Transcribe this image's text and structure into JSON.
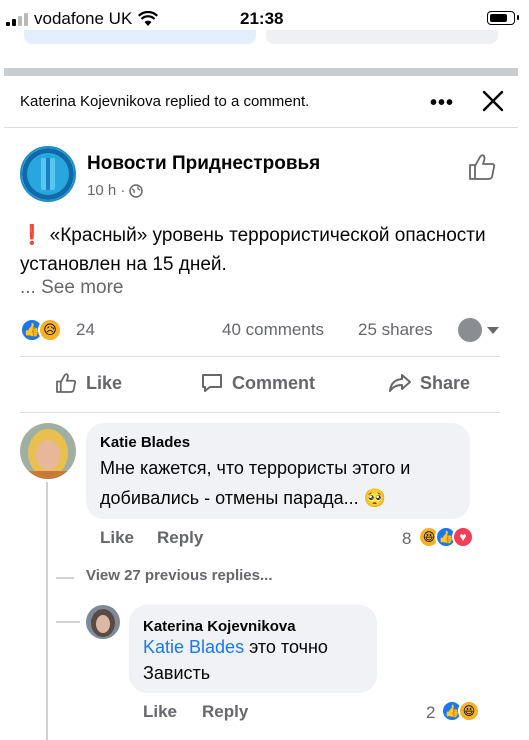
{
  "status_bar": {
    "carrier": "vodafone UK",
    "time": "21:38"
  },
  "notification": {
    "text": "Katerina Kojevnikova replied to a comment."
  },
  "post": {
    "page_name": "Новости Приднестровья",
    "time": "10 h ·",
    "text": "«Красный» уровень террористической опасности установлен на 15 дней.",
    "see_more": "... See more",
    "reaction_count": "24",
    "comments": "40 comments",
    "shares": "25 shares",
    "actions": {
      "like": "Like",
      "comment": "Comment",
      "share": "Share"
    }
  },
  "comments": [
    {
      "author": "Katie Blades",
      "text": "Мне кажется, что террористы этого и добивались - отмены парада...",
      "like": "Like",
      "reply": "Reply",
      "reaction_count": "8"
    }
  ],
  "view_previous": "View 27 previous replies...",
  "reply": {
    "author": "Katerina Kojevnikova",
    "mention": "Katie Blades",
    "text_rest": "это точно",
    "text_line2": "Зависть",
    "like": "Like",
    "reply": "Reply",
    "reaction_count": "2"
  },
  "colors": {
    "brand_blue": "#1877f2",
    "secondary_text": "#65676b",
    "bubble_bg": "#f0f2f5",
    "alert_red": "#e02020"
  }
}
